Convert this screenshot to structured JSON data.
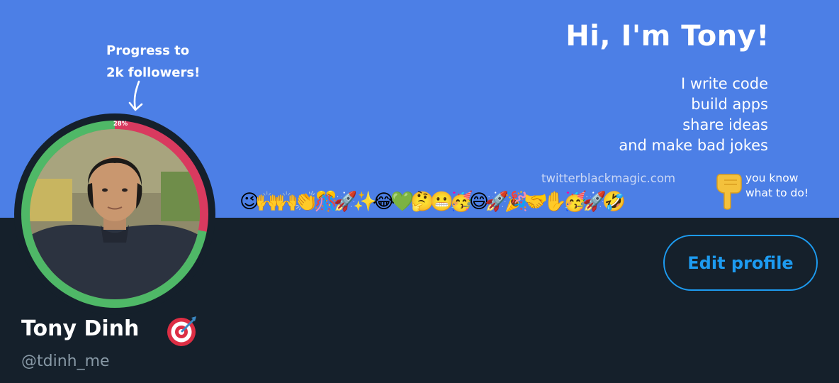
{
  "banner": {
    "headline": "Hi, I'm Tony!",
    "tagline": [
      "I write code",
      "build apps",
      "share ideas",
      "and make bad jokes"
    ],
    "site": "twitterblackmagic.com",
    "progress_note": [
      "Progress to",
      "2k followers!"
    ],
    "progress_value": 0.28,
    "progress_label": "28%",
    "emoji_row": "😉🙌🙌👏🎊🚀✨😂💚🤔😬🥳😄🚀🎉🤝✋🥳🚀🤣",
    "cta": [
      "you know",
      "what to do!"
    ]
  },
  "profile": {
    "display_name": "Tony Dinh",
    "name_emoji_icon": "direct-hit-target-icon",
    "handle": "@tdinh_me",
    "edit_button": "Edit profile"
  },
  "colors": {
    "banner": "#4c7fe6",
    "background": "#15202b",
    "progress_filled": "#d93a5f",
    "progress_remaining": "#4fb867",
    "accent": "#1d9bf0",
    "handle": "#8899a6"
  }
}
